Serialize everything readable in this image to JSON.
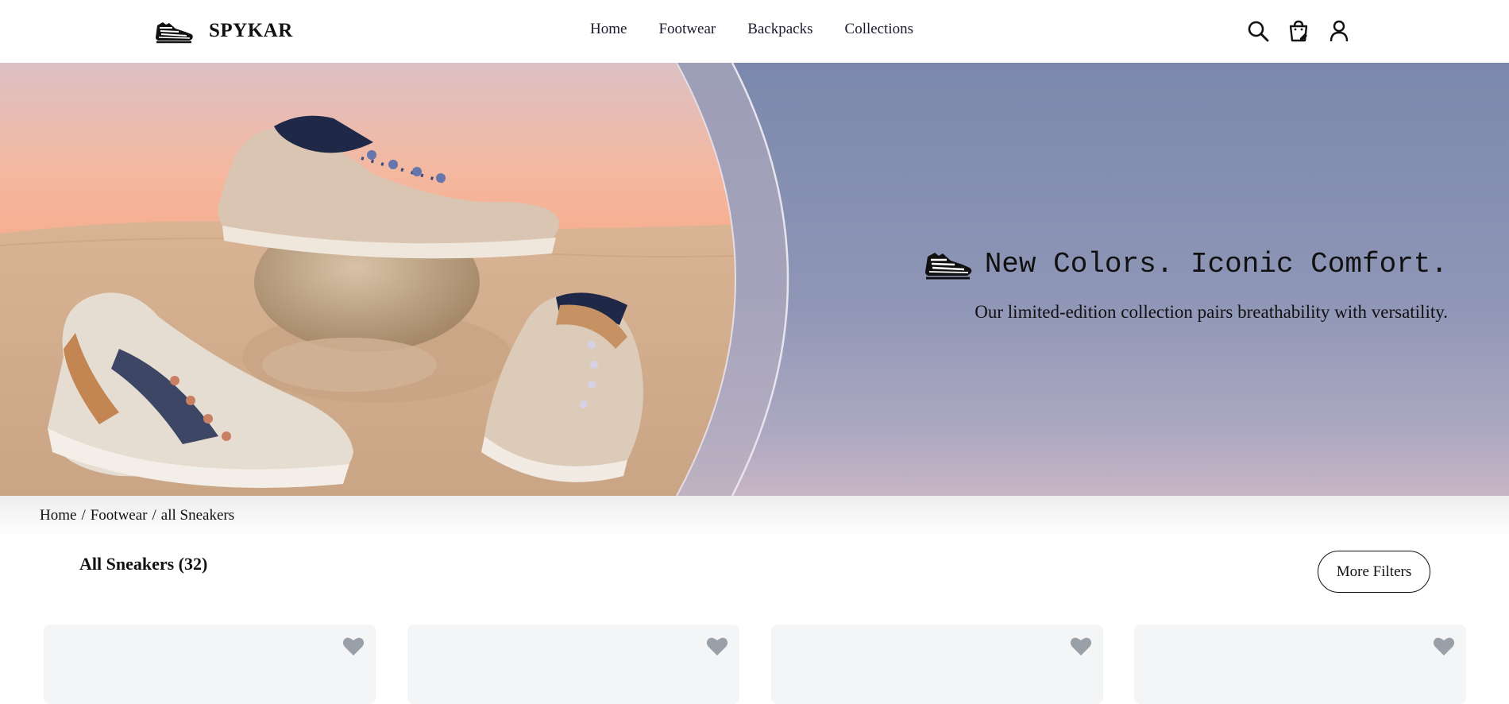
{
  "brand": {
    "name": "SPYKAR",
    "logo_icon": "sneaker-logo-icon"
  },
  "nav": {
    "items": [
      {
        "label": "Home"
      },
      {
        "label": "Footwear"
      },
      {
        "label": "Backpacks"
      },
      {
        "label": "Collections"
      }
    ]
  },
  "header_icons": [
    "search-icon",
    "cart-icon",
    "user-icon"
  ],
  "hero": {
    "title": "New Colors. Iconic Comfort.",
    "subtitle": "Our limited-edition collection pairs breathability with versatility.",
    "title_icon": "sneaker-icon"
  },
  "breadcrumb": {
    "items": [
      "Home",
      "Footwear",
      "all Sneakers"
    ],
    "separator": "/"
  },
  "listing": {
    "title": "All Sneakers (32)",
    "filters_label": "More Filters"
  },
  "cards": [
    {
      "wishlist_icon": "heart-icon"
    },
    {
      "wishlist_icon": "heart-icon"
    },
    {
      "wishlist_icon": "heart-icon"
    },
    {
      "wishlist_icon": "heart-icon"
    }
  ],
  "colors": {
    "hero_bg": "#8b93b4",
    "card_bg": "#f4f5f7",
    "heart": "#9aa0a8",
    "text": "#111111"
  }
}
